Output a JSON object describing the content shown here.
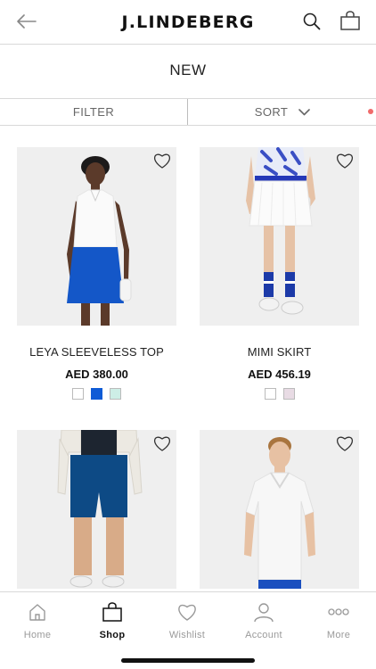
{
  "header": {
    "logo": "J.LINDEBERG"
  },
  "page": {
    "title": "NEW"
  },
  "filter_bar": {
    "filter_label": "FILTER",
    "sort_label": "SORT"
  },
  "products": [
    {
      "name": "LEYA SLEEVELESS TOP",
      "price": "AED 380.00",
      "swatches": [
        "#ffffff",
        "#0f5bd6",
        "#cdeee6"
      ]
    },
    {
      "name": "MIMI SKIRT",
      "price": "AED 456.19",
      "swatches": [
        "#ffffff",
        "#e8dbe4"
      ]
    },
    {
      "name": "",
      "price": "",
      "swatches": []
    },
    {
      "name": "",
      "price": "",
      "swatches": []
    }
  ],
  "tabbar": {
    "tabs": [
      {
        "label": "Home",
        "icon": "home-icon",
        "active": false
      },
      {
        "label": "Shop",
        "icon": "shopping-bag-icon",
        "active": true
      },
      {
        "label": "Wishlist",
        "icon": "heart-icon",
        "active": false
      },
      {
        "label": "Account",
        "icon": "person-icon",
        "active": false
      },
      {
        "label": "More",
        "icon": "more-dots-icon",
        "active": false
      }
    ]
  },
  "colors": {
    "accent_dot": "#f06b6b",
    "text_primary": "#111111",
    "text_muted": "#9a9a9a",
    "divider": "#d9d9d9"
  }
}
